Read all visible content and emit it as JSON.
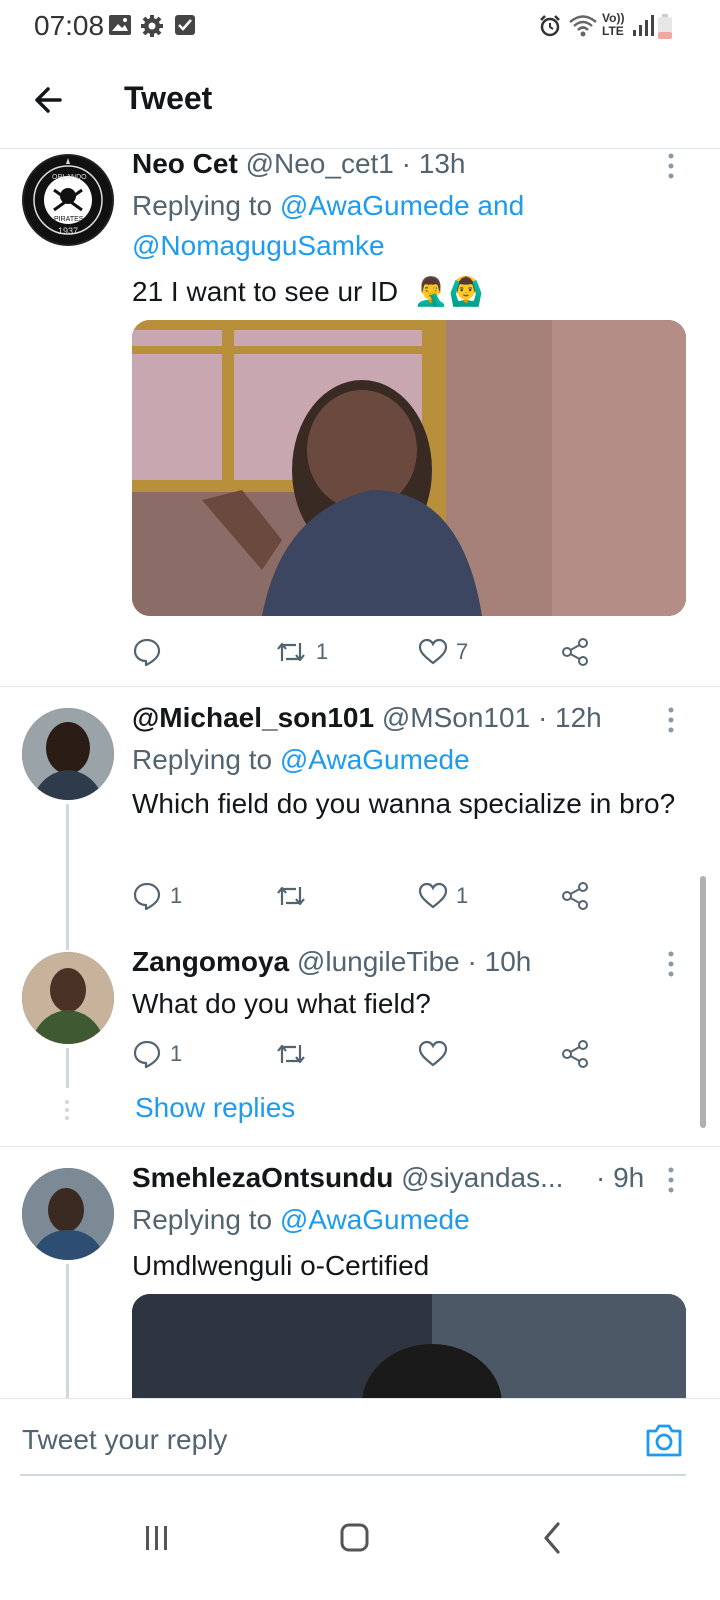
{
  "status_bar": {
    "time": "07:08",
    "left_icons": [
      "image-icon",
      "gear-icon",
      "checkbox-icon"
    ],
    "right_icons": [
      "alarm-icon",
      "wifi-icon",
      "volte-icon",
      "signal-icon",
      "battery-icon"
    ],
    "volte_label_top": "Vo))",
    "volte_label_bottom": "LTE",
    "battery_color": "#f4a6a0"
  },
  "header": {
    "title": "Tweet",
    "back_icon": "arrow-left-icon"
  },
  "accent_color": "#1d9bf0",
  "tweets": [
    {
      "name": "Neo Cet",
      "handle": "@Neo_cet1",
      "time": "· 13h",
      "replying_prefix": "Replying to ",
      "replying_to": [
        "@AwaGumede",
        "@NomaguguSamke"
      ],
      "replying_joiner": " and",
      "text": "21 I want to see ur ID",
      "emoji": "🤦‍♂️🙆‍♂️",
      "avatar_badge_text": "1937",
      "avatar_badge_top": "ORLANDO",
      "avatar_badge_bottom": "PIRATES",
      "has_media": true,
      "replies": "",
      "retweets": "1",
      "likes": "7"
    },
    {
      "name": "@Michael_son101",
      "handle": "@MSon101",
      "time": "· 12h",
      "replying_prefix": "Replying to ",
      "replying_to": [
        "@AwaGumede"
      ],
      "text": "Which field do you wanna specialize in bro?",
      "replies": "1",
      "retweets": "",
      "likes": "1"
    },
    {
      "name": "Zangomoya",
      "handle": "@lungileTibe",
      "time": "· 10h",
      "text": "What do you what field?",
      "replies": "1",
      "retweets": "",
      "likes": "",
      "show_replies": "Show replies"
    },
    {
      "name": "SmehlezaOntsundu",
      "handle": "@siyandas...",
      "time": "· 9h",
      "replying_prefix": "Replying to ",
      "replying_to": [
        "@AwaGumede"
      ],
      "text": "Umdlwenguli o-Certified",
      "has_media": true
    }
  ],
  "reply_bar": {
    "placeholder": "Tweet your reply",
    "camera_icon": "camera-icon"
  },
  "nav_bar": {
    "buttons": [
      "recents-icon",
      "home-icon",
      "back-icon"
    ]
  }
}
